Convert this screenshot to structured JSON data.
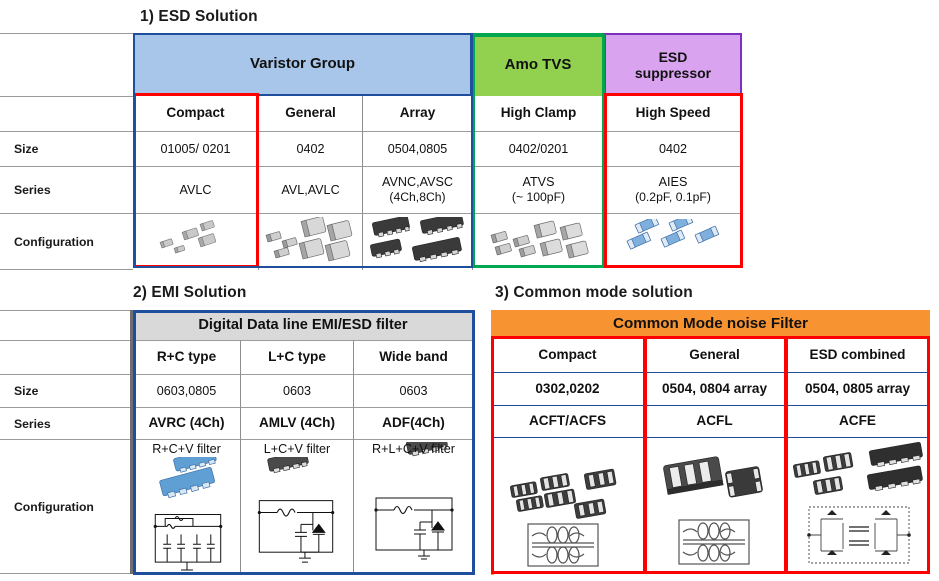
{
  "sections": {
    "esd": {
      "title": "1)  ESD Solution"
    },
    "emi": {
      "title": "2) EMI Solution"
    },
    "cm": {
      "title": "3)  Common mode solution"
    }
  },
  "row_labels": {
    "size": "Size",
    "series": "Series",
    "configuration": "Configuration"
  },
  "esd_table": {
    "group_headers": [
      {
        "label": "Varistor  Group",
        "color": "#a8c6ea",
        "border": "#1f4e9c",
        "span": 3
      },
      {
        "label": "Amo TVS",
        "color": "#92d050",
        "border": "#00a650",
        "span": 1
      },
      {
        "label": "ESD\nsuppressor",
        "line1": "ESD",
        "line2": "suppressor",
        "color": "#d9a3f0",
        "border": "#7b2fbe",
        "span": 1
      }
    ],
    "columns": [
      {
        "name": "Compact",
        "size": "01005/ 0201",
        "series_l1": "AVLC",
        "series_l2": ""
      },
      {
        "name": "General",
        "size": "0402",
        "series_l1": "AVL,AVLC",
        "series_l2": ""
      },
      {
        "name": "Array",
        "size": "0504,0805",
        "series_l1": "AVNC,AVSC",
        "series_l2": "(4Ch,8Ch)"
      },
      {
        "name": "High Clamp",
        "size": "0402/0201",
        "series_l1": "ATVS",
        "series_l2": "(~ 100pF)"
      },
      {
        "name": "High Speed",
        "size": "0402",
        "series_l1": "AIES",
        "series_l2": "(0.2pF, 0.1pF)"
      }
    ],
    "highlights": [
      {
        "target": "Compact",
        "color": "#ff0000"
      },
      {
        "target": "High Clamp",
        "color": "#00a650"
      },
      {
        "target": "High Speed",
        "color": "#ff0000"
      }
    ]
  },
  "emi_table": {
    "group_header": {
      "label": "Digital Data line EMI/ESD filter",
      "color": "#d9d9d9"
    },
    "columns": [
      {
        "name": "R+C type",
        "size": "0603,0805",
        "series": "AVRC (4Ch)",
        "config_caption": "R+C+V filter"
      },
      {
        "name": "L+C type",
        "size": "0603",
        "series": "AMLV (4Ch)",
        "config_caption": "L+C+V filter"
      },
      {
        "name": "Wide band",
        "size": "0603",
        "series": "ADF(4Ch)",
        "config_caption": "R+L+C+V filter"
      }
    ],
    "outline_color": "#1f4e9c"
  },
  "cm_table": {
    "group_header": {
      "label": "Common Mode noise Filter",
      "color": "#f79331"
    },
    "columns": [
      {
        "name": "Compact",
        "size": "0302,0202",
        "series": "ACFT/ACFS"
      },
      {
        "name": "General",
        "size": "0504, 0804  array",
        "series": "ACFL"
      },
      {
        "name": "ESD combined",
        "size": "0504, 0805  array",
        "series": "ACFE"
      }
    ],
    "highlight_color": "#ff0000"
  }
}
